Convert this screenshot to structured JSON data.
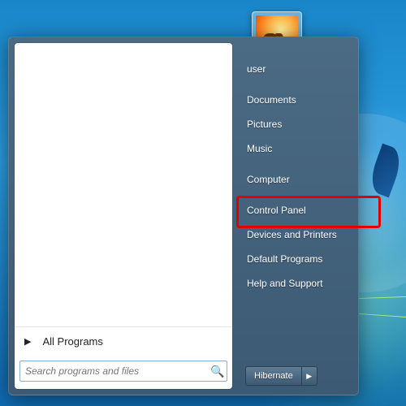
{
  "user_name": "user",
  "right_items": [
    {
      "label": "Documents"
    },
    {
      "label": "Pictures"
    },
    {
      "label": "Music"
    },
    {
      "label": "Computer"
    },
    {
      "label": "Control Panel",
      "highlighted": true
    },
    {
      "label": "Devices and Printers"
    },
    {
      "label": "Default Programs"
    },
    {
      "label": "Help and Support"
    }
  ],
  "all_programs_label": "All Programs",
  "search_placeholder": "Search programs and files",
  "power_label": "Hibernate"
}
